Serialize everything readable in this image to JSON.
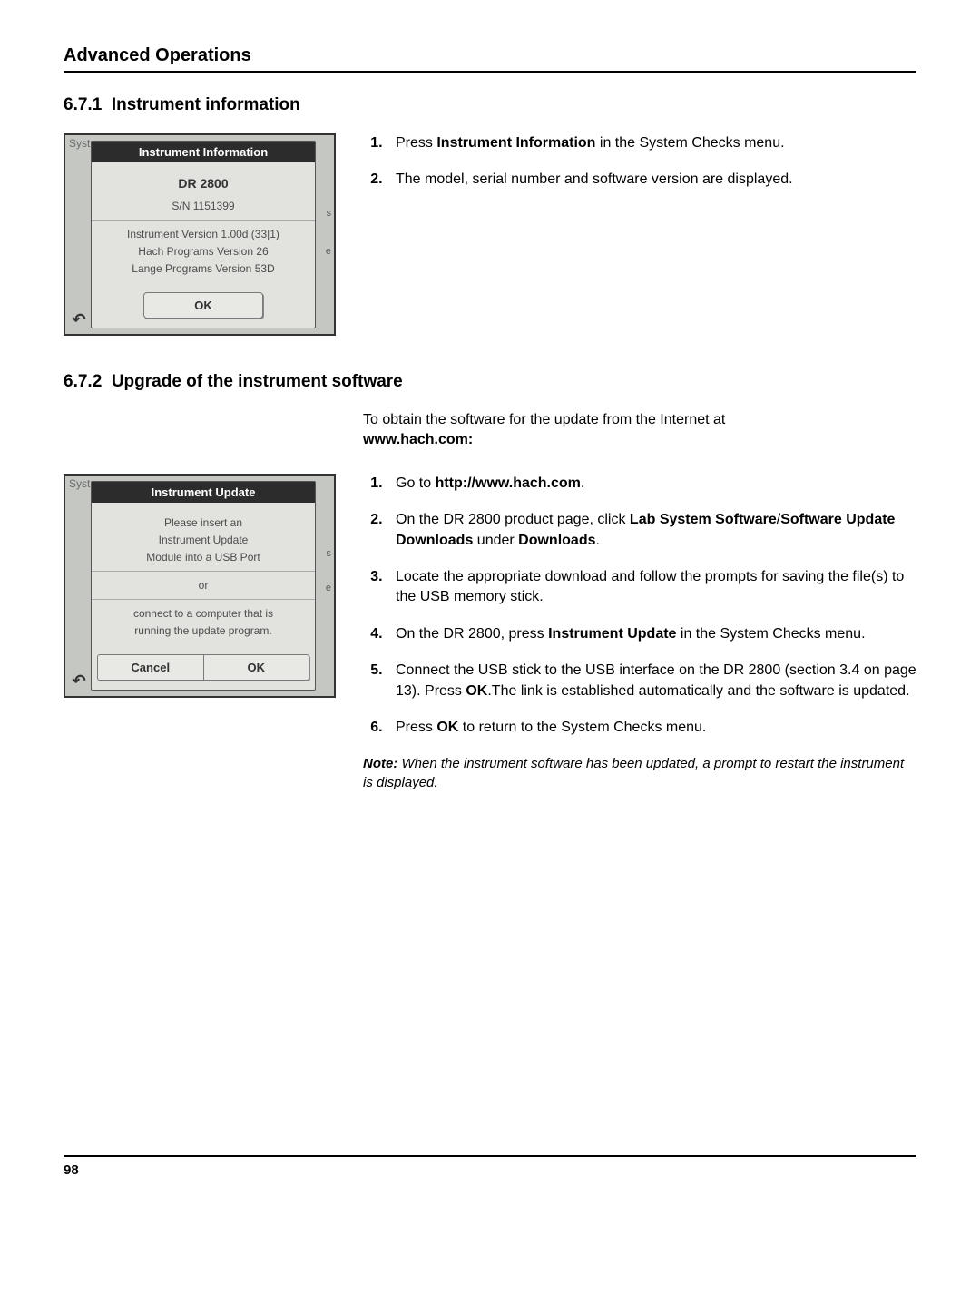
{
  "header": "Advanced Operations",
  "section1": {
    "number": "6.7.1",
    "title": "Instrument information",
    "dialog": {
      "title": "Instrument Information",
      "model": "DR 2800",
      "serial": "S/N 1151399",
      "ver1": "Instrument Version 1.00d  (33|1)",
      "ver2": "Hach Programs Version 26",
      "ver3": "Lange Programs Version 53D",
      "ok": "OK"
    },
    "bglabel": "Syst",
    "edge1": "s",
    "edge2": "e",
    "steps": {
      "1_a": "Press ",
      "1_bold": "Instrument Information",
      "1_b": " in the System Checks menu.",
      "2": "The model, serial number and software version are displayed."
    }
  },
  "section2": {
    "number": "6.7.2",
    "title": "Upgrade of the instrument software",
    "intro_a": "To obtain the software for the update from the Internet at ",
    "intro_bold": "www.hach.com:",
    "dialog": {
      "title": "Instrument Update",
      "line1": "Please insert an",
      "line2": "Instrument Update",
      "line3": "Module into a USB Port",
      "or": "or",
      "line4": "connect to a computer that is",
      "line5": "running the update program.",
      "cancel": "Cancel",
      "ok": "OK"
    },
    "bglabel": "Syst",
    "edge1": "s",
    "edge2": "e",
    "steps": {
      "1_a": "Go to ",
      "1_bold": "http://www.hach.com",
      "1_b": ".",
      "2_a": "On the DR 2800 product page, click ",
      "2_bold1": "Lab System Software",
      "2_sep": "/",
      "2_bold2": "Software Update Downloads",
      "2_mid": " under ",
      "2_bold3": "Downloads",
      "2_end": ".",
      "3": "Locate the appropriate download and follow the prompts for saving the file(s) to the USB memory stick.",
      "4_a": "On the DR 2800, press ",
      "4_bold": "Instrument Update",
      "4_b": " in the System Checks menu.",
      "5_a": "Connect the USB stick to the USB interface on the DR 2800 (section 3.4 on page 13). Press ",
      "5_bold": "OK",
      "5_b": ".The link is established automatically and the software is updated.",
      "6_a": "Press ",
      "6_bold": "OK",
      "6_b": " to return to the System Checks menu."
    },
    "note": {
      "label": "Note:",
      "text": " When the instrument software has been updated, a prompt to restart the instrument is displayed."
    }
  },
  "page_number": "98"
}
